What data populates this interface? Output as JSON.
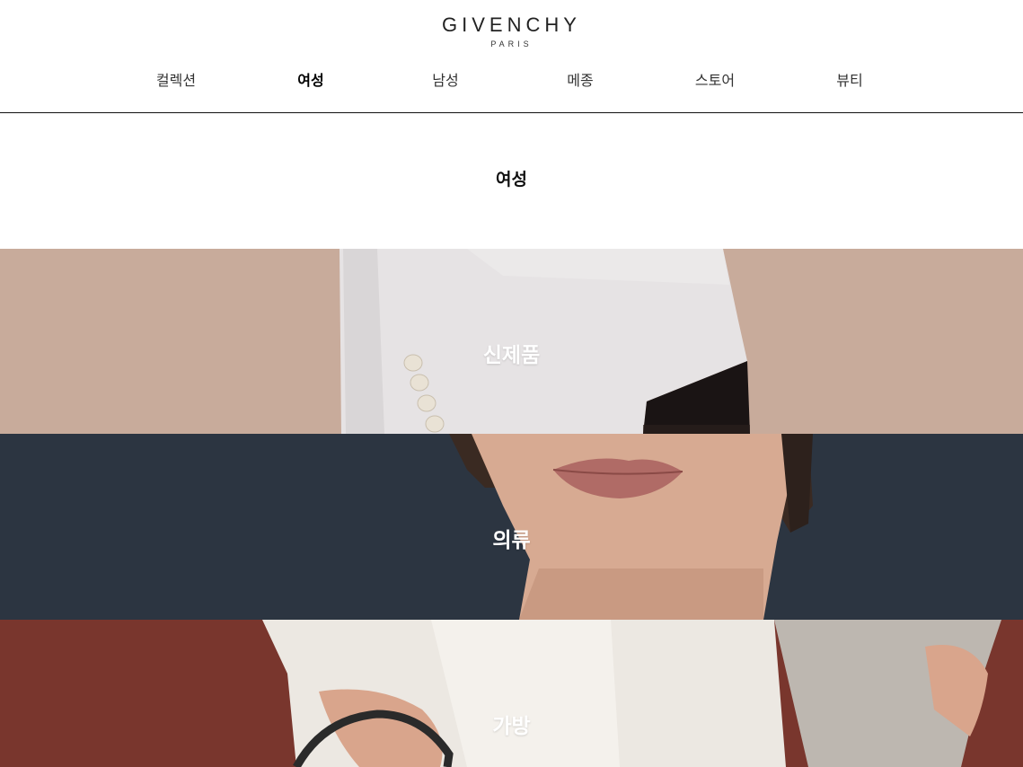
{
  "brand": {
    "name": "GIVENCHY",
    "sub": "PARIS"
  },
  "nav": {
    "items": [
      {
        "label": "컬렉션"
      },
      {
        "label": "여성"
      },
      {
        "label": "남성"
      },
      {
        "label": "메종"
      },
      {
        "label": "스토어"
      },
      {
        "label": "뷰티"
      }
    ],
    "active": "여성"
  },
  "page": {
    "title": "여성"
  },
  "categories": [
    {
      "label": "신제품",
      "bg": "#c8ab9b"
    },
    {
      "label": "의류",
      "bg": "#2c3541"
    },
    {
      "label": "가방",
      "bg": "#79362d"
    }
  ],
  "colors": {
    "header_border": "#111111",
    "banner_text": "#ffffff"
  }
}
